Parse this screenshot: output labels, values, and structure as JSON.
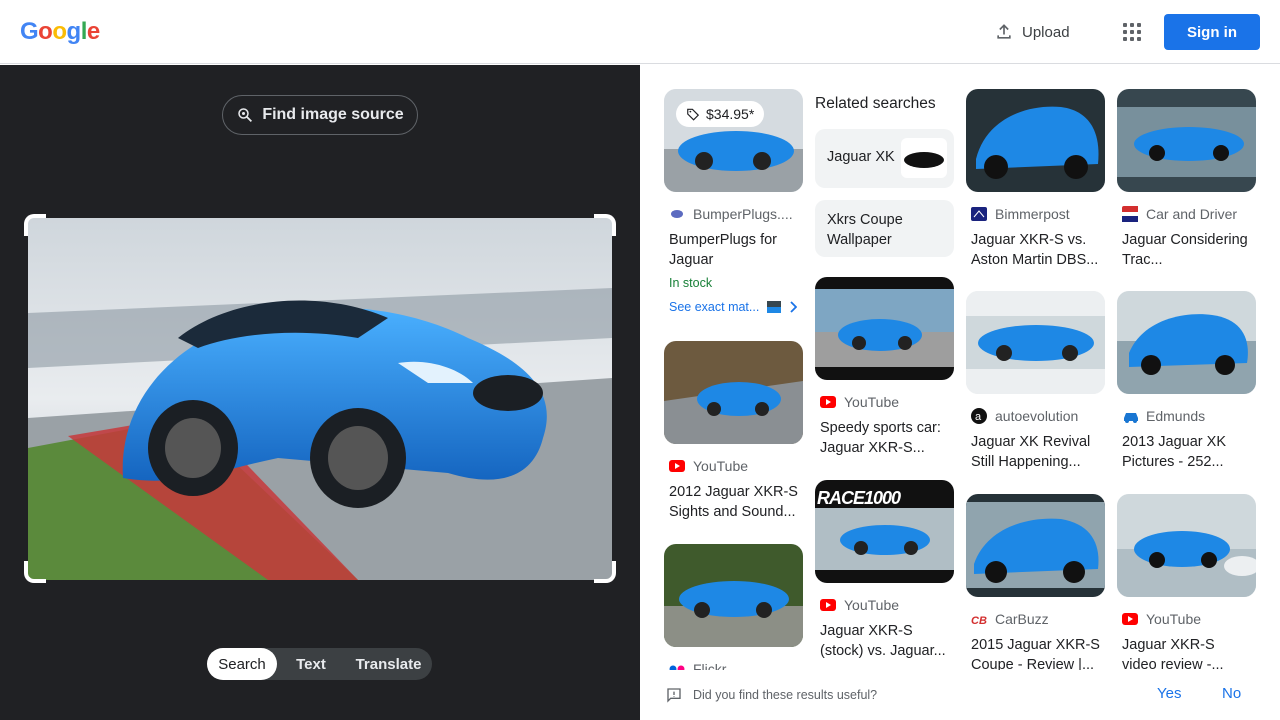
{
  "header": {
    "logo": [
      "G",
      "o",
      "o",
      "g",
      "l",
      "e"
    ],
    "logo_colors": [
      "#4285F4",
      "#EA4335",
      "#FBBC05",
      "#4285F4",
      "#34A853",
      "#EA4335"
    ],
    "upload_label": "Upload",
    "signin_label": "Sign in"
  },
  "left": {
    "find_source_label": "Find image source",
    "modes": [
      {
        "label": "Search",
        "active": true
      },
      {
        "label": "Text",
        "active": false
      },
      {
        "label": "Translate",
        "active": false
      }
    ]
  },
  "results": {
    "col1": [
      {
        "price": "$34.95*",
        "source": "BumperPlugs....",
        "title": "BumperPlugs for Jaguar",
        "stock": "In stock",
        "exact": "See exact mat..."
      },
      {
        "source": "YouTube",
        "title": "2012 Jaguar XKR-S Sights and Sound..."
      },
      {
        "source": "Flickr",
        "title": ""
      }
    ],
    "related_title": "Related searches",
    "related": [
      {
        "label": "Jaguar XK"
      },
      {
        "label": "Xkrs Coupe Wallpaper"
      }
    ],
    "col2": [
      {
        "source": "YouTube",
        "title": "Speedy sports car: Jaguar XKR-S..."
      },
      {
        "source": "YouTube",
        "title": "Jaguar XKR-S (stock) vs. Jaguar...",
        "overlay": "RACE1000"
      }
    ],
    "col3": [
      {
        "source": "Bimmerpost",
        "title": "Jaguar XKR-S vs. Aston Martin DBS..."
      },
      {
        "source": "autoevolution",
        "title": "Jaguar XK Revival Still Happening..."
      },
      {
        "source": "CarBuzz",
        "title": "2015 Jaguar XKR-S Coupe - Review |..."
      }
    ],
    "col4": [
      {
        "source": "Car and Driver",
        "title": "Jaguar Considering Trac..."
      },
      {
        "source": "Edmunds",
        "title": "2013 Jaguar XK Pictures - 252..."
      },
      {
        "source": "YouTube",
        "title": "Jaguar XKR-S video review -..."
      }
    ]
  },
  "feedback": {
    "question": "Did you find these results useful?",
    "yes": "Yes",
    "no": "No"
  },
  "colors": {
    "accent": "#1a73e8",
    "dark_panel": "#202124",
    "car_blue": "#1e88e5"
  }
}
